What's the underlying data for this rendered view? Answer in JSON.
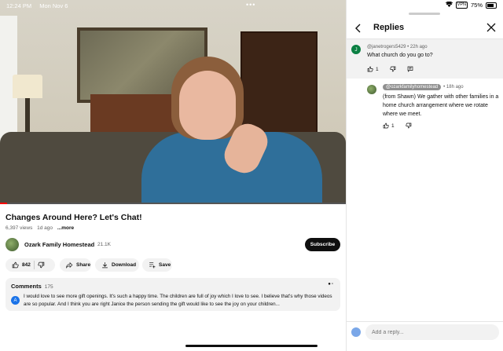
{
  "status_bar": {
    "time": "12:24 PM",
    "date": "Mon Nov 6",
    "more_dots": "•••",
    "vpn": "VPN",
    "battery": "75%"
  },
  "video": {
    "progress": 0.02,
    "title": "Changes Around Here? Let's Chat!",
    "views": "6,397 views",
    "age": "1d ago",
    "more": "...more"
  },
  "channel": {
    "name": "Ozark Family Homestead",
    "subscribers": "21.1K",
    "subscribe_label": "Subscribe"
  },
  "actions": {
    "likes": "842",
    "share": "Share",
    "download": "Download",
    "save": "Save"
  },
  "comments": {
    "label": "Comments",
    "count": "175",
    "avatar_letter": "A",
    "preview": "I would love to see more gift openings. It's such a happy time. The children are full of joy which I love to see. I believe that's why those videos are so popular. And I think you are right Janice the person sending the gift would like to see the joy on your children..."
  },
  "replies_panel": {
    "title": "Replies",
    "top_comment": {
      "avatar_letter": "J",
      "user": "@janetrogers5429",
      "ago": "• 22h ago",
      "text": "What church do you go to?",
      "likes": "1"
    },
    "reply": {
      "user": "@ozarkfamilyhomestead",
      "ago": "• 18h ago",
      "text": "(from Shawn) We gather with other families in a home church arrangement where we rotate where we meet.",
      "likes": "1"
    },
    "input_placeholder": "Add a reply..."
  }
}
